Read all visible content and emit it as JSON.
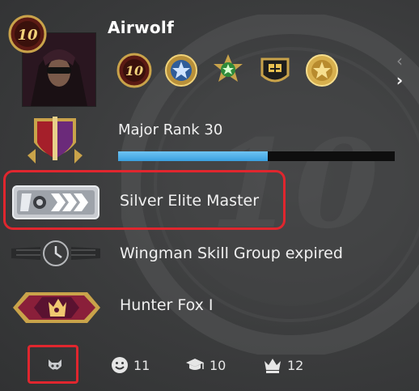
{
  "profile": {
    "username": "Airwolf",
    "level": "10"
  },
  "medals": [
    {
      "name": "service-medal-10-icon"
    },
    {
      "name": "blue-star-medal-icon"
    },
    {
      "name": "green-star-medal-icon"
    },
    {
      "name": "gold-bomb-medal-icon"
    },
    {
      "name": "gold-star-coin-icon"
    }
  ],
  "rank": {
    "label": "Major Rank 30",
    "xp_progress": 0.54
  },
  "competitive": {
    "label": "Silver Elite Master"
  },
  "wingman": {
    "label": "Wingman Skill Group expired"
  },
  "danger_zone": {
    "label": "Hunter Fox I"
  },
  "commendations": {
    "friendly": "11",
    "teacher": "10",
    "leader": "12"
  },
  "watermark_text": "10",
  "colors": {
    "accent_blue": "#4aaeea",
    "highlight_red": "#e0262e",
    "gold": "#d4a63a"
  }
}
